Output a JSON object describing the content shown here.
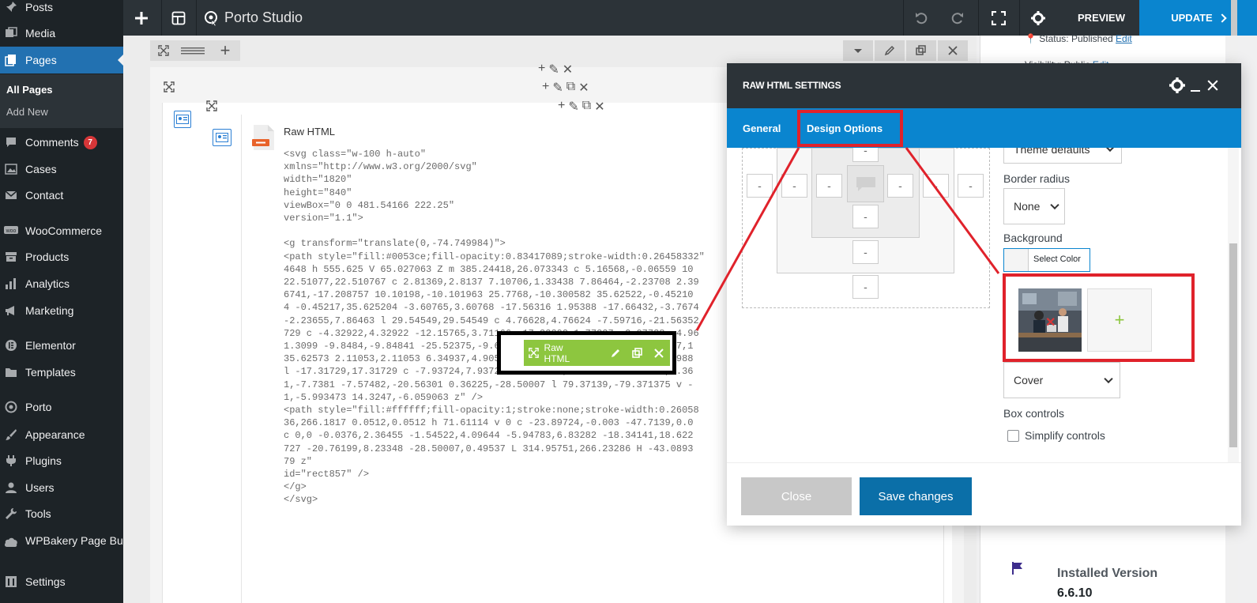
{
  "sidebar": {
    "items": [
      {
        "id": "posts",
        "label": "Posts"
      },
      {
        "id": "media",
        "label": "Media"
      },
      {
        "id": "pages",
        "label": "Pages"
      },
      {
        "id": "comments",
        "label": "Comments",
        "badge": "7"
      },
      {
        "id": "cases",
        "label": "Cases"
      },
      {
        "id": "contact",
        "label": "Contact"
      },
      {
        "id": "woocommerce",
        "label": "WooCommerce"
      },
      {
        "id": "products",
        "label": "Products"
      },
      {
        "id": "analytics",
        "label": "Analytics"
      },
      {
        "id": "marketing",
        "label": "Marketing"
      },
      {
        "id": "elementor",
        "label": "Elementor"
      },
      {
        "id": "templates",
        "label": "Templates"
      },
      {
        "id": "porto",
        "label": "Porto"
      },
      {
        "id": "appearance",
        "label": "Appearance"
      },
      {
        "id": "plugins",
        "label": "Plugins"
      },
      {
        "id": "users",
        "label": "Users"
      },
      {
        "id": "tools",
        "label": "Tools"
      },
      {
        "id": "wpbakery",
        "label": "WPBakery Page Builder"
      },
      {
        "id": "settings",
        "label": "Settings"
      }
    ],
    "submenu": {
      "all_pages": "All Pages",
      "add_new": "Add New"
    }
  },
  "topbar": {
    "title": "Porto Studio",
    "preview": "PREVIEW",
    "update": "UPDATE"
  },
  "element": {
    "name": "Raw HTML",
    "code": "<svg class=\"w-100 h-auto\"\nxmlns=\"http://www.w3.org/2000/svg\"\nwidth=\"1820\"\nheight=\"840\"\nviewBox=\"0 0 481.54166 222.25\"\nversion=\"1.1\">\n\n<g transform=\"translate(0,-74.749984)\">\n<path style=\"fill:#0053ce;fill-opacity:0.83417089;stroke-width:0.26458332\"\n4648 h 555.625 V 65.027063 Z m 385.24418,26.073343 c 5.16568,-0.06559 10\n22.51077,22.510767 c 2.81369,2.8137 7.10706,1.33438 7.86464,-2.23708 2.39\n6741,-17.208757 10.10198,-10.101963 25.7768,-10.300582 35.62522,-0.45210\n4 -0.45217,35.625204 -3.60765,3.60768 -17.56316 1.95388 -17.66432,-3.7674\n-2.23655,7.86463 l 29.54549,29.54549 c 4.76628,4.76624 -7.59716,-21.56352\n729 c -4.32922,4.32922 -12.15765,3.71166 -17.33392,1.77337 -2.07738,-4.96\n1.3099 -9.8484,-9.84841 -25.52375,-9.64979 -35.62572,0.45217 -10.10177,1\n35.62573 2.11053,2.11053 6.34937,4.90595 11.30941,6.98045 4.94276,3.4988\nl -17.31729,17.31729 c -7.93724,7.93726 -20.76249,8.09984 -28.50057,0.36\n1,-7.7381 -7.57482,-20.56301 0.36225,-28.50007 l 79.37139,-79.371375 v -\n1,-5.993473 14.3247,-6.059063 z\" />\n<path style=\"fill:#ffffff;fill-opacity:1;stroke:none;stroke-width:0.26058\n36,266.1817 0.0512,0.0512 h 71.61114 v 0 c -23.89724,-0.003 -47.7139,0.0\nc 0,0 -0.0376,2.36455 -1.54522,4.09644 -5.94783,6.83282 -18.34141,18.622\n727 -20.76199,8.23348 -28.50007,0.49537 L 314.95751,266.23286 H -43.0893\n79 z\"\nid=\"rect857\" />\n</g>\n</svg>",
    "float_label": "Raw HTML"
  },
  "modal": {
    "title": "RAW HTML SETTINGS",
    "tabs": [
      "General",
      "Design Options"
    ],
    "active_tab": "Design Options",
    "spinner_placeholder": "-",
    "fields": {
      "theme_defaults_partial": "Theme defaults",
      "border_radius_label": "Border radius",
      "border_radius_value": "None",
      "background_label": "Background",
      "select_color": "Select Color",
      "add_image": "+",
      "bg_style_value": "Cover",
      "box_controls_label": "Box controls",
      "simplify_controls": "Simplify controls"
    },
    "close": "Close",
    "save": "Save changes"
  },
  "side_panel": {
    "status": "Status: Published",
    "status_edit": "Edit",
    "visibility": "Visibility: Public",
    "visibility_edit": "Edit",
    "installed_version_label": "Installed Version",
    "installed_version_value": "6.6.10"
  },
  "colors": {
    "wp_dark": "#1d2327",
    "accent_blue": "#0a85cf",
    "highlight_red": "#e0222b",
    "element_green": "#8dc63f"
  }
}
